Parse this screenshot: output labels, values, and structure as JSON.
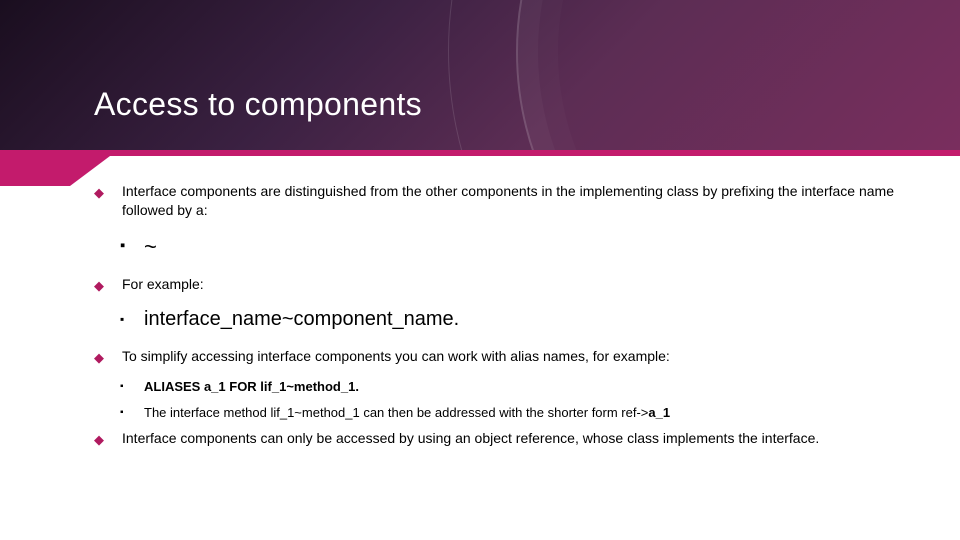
{
  "title": "Access to components",
  "bullets": {
    "b1": "Interface components are distinguished from the other components in the implementing class by prefixing the interface name followed by a:",
    "b1_sub": "~",
    "b2": "For example:",
    "b2_sub": "interface_name~component_name.",
    "b3": "To simplify accessing interface components you can work with alias names, for example:",
    "b3_sub1_prefix": "ALIASES a_1 FOR lif_1~method_1",
    "b3_sub1_dot": ".",
    "b3_sub2_text": "The interface method lif_1~method_1 can then be addressed with the shorter form ref->",
    "b3_sub2_bold": "a_1",
    "b4": "Interface components can only be accessed by using an object reference, whose class implements the interface."
  }
}
